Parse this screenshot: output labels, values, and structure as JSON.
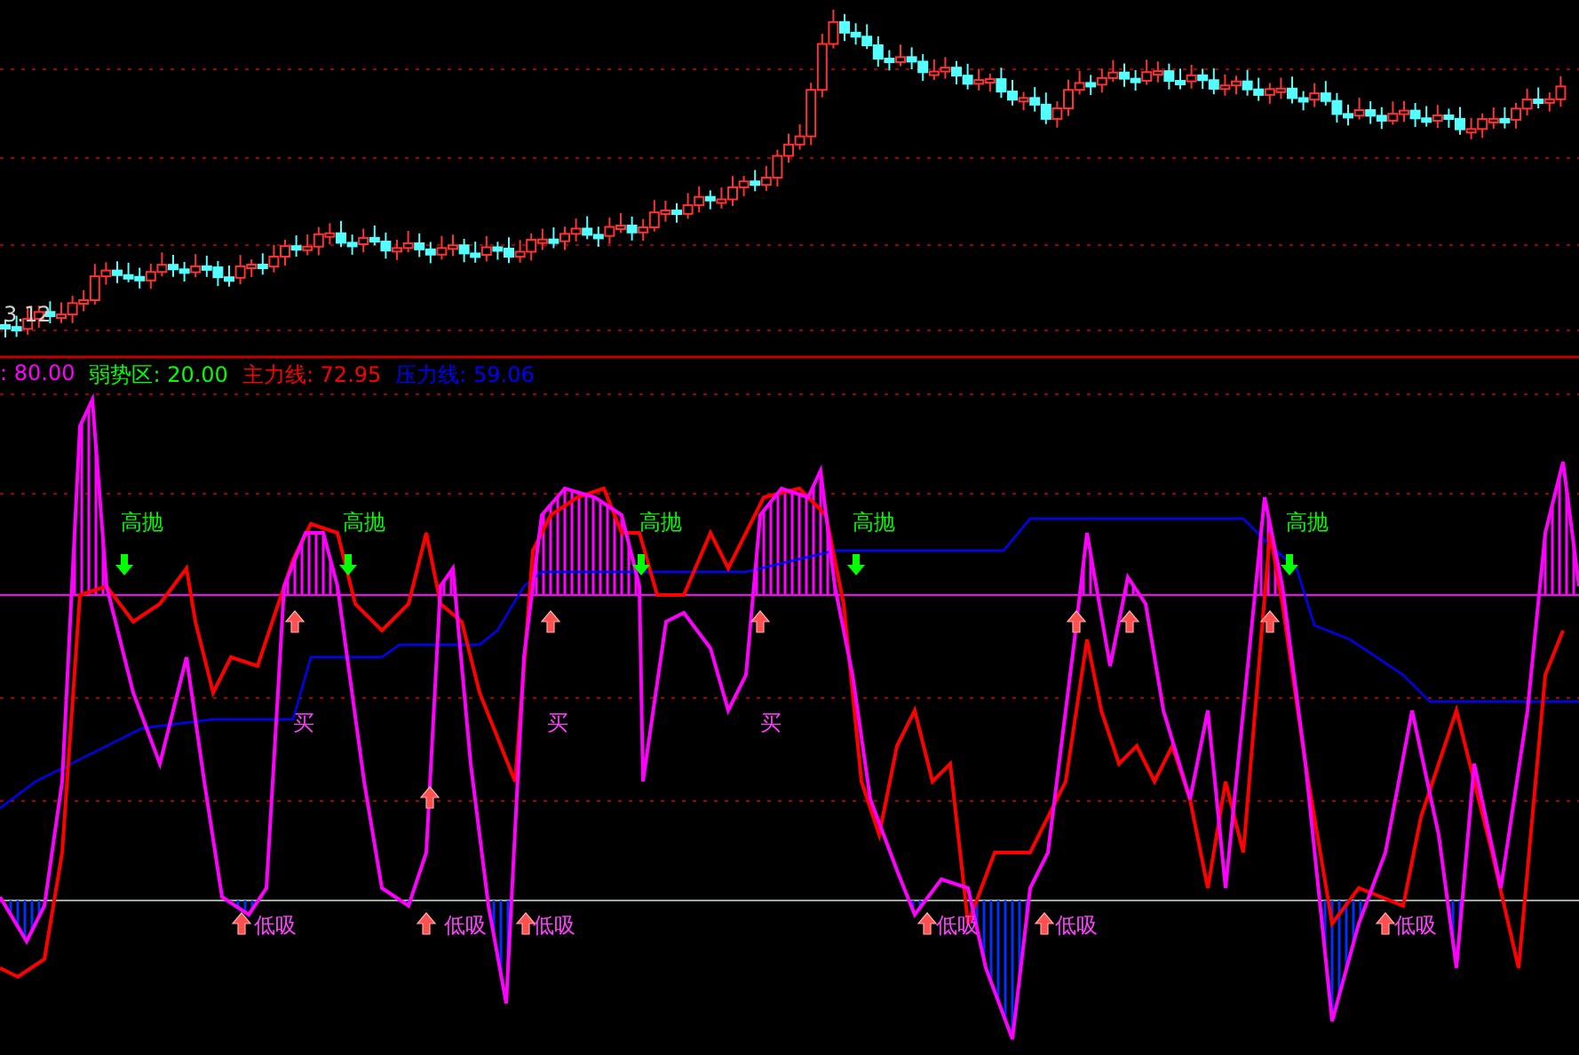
{
  "price_panel": {
    "low_label": "3.12"
  },
  "indicator_header": [
    {
      "text": ": 80.00",
      "color": "#ff00ff"
    },
    {
      "text": "弱势区: 20.00",
      "color": "#00ff00"
    },
    {
      "text": "主力线: 72.95",
      "color": "#ff0000"
    },
    {
      "text": "压力线: 59.06",
      "color": "#0000ff"
    }
  ],
  "sell_signals": [
    {
      "label": "高抛"
    },
    {
      "label": "高抛"
    },
    {
      "label": "高抛"
    },
    {
      "label": "高抛"
    },
    {
      "label": "高抛"
    }
  ],
  "buy_signals": [
    {
      "label": "买"
    },
    {
      "label": "买"
    },
    {
      "label": "买"
    }
  ],
  "dip_signals": [
    {
      "label": "低吸"
    },
    {
      "label": "低吸"
    },
    {
      "label": "低吸"
    },
    {
      "label": "低吸"
    },
    {
      "label": "低吸"
    },
    {
      "label": "低吸"
    }
  ]
}
